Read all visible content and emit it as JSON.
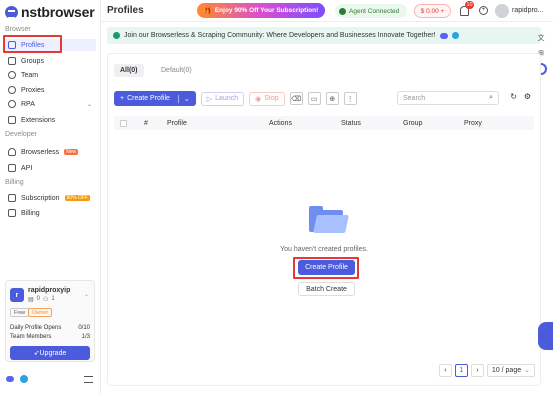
{
  "app": {
    "name": "nstbrowser",
    "page_title": "Profiles"
  },
  "header": {
    "promo_label": "Enjoy 90% Off Your Subscription!",
    "agent_status": "Agent Connected",
    "balance": "$ 0.00 +",
    "notification_count": "10",
    "user_name": "rapidpro..."
  },
  "sidebar": {
    "section_browser": "Browser",
    "section_developer": "Developer",
    "section_billing": "Billing",
    "items": [
      {
        "label": "Profiles"
      },
      {
        "label": "Groups"
      },
      {
        "label": "Team"
      },
      {
        "label": "Proxies"
      },
      {
        "label": "RPA"
      },
      {
        "label": "Extensions"
      },
      {
        "label": "Browserless",
        "badge": "New"
      },
      {
        "label": "API"
      },
      {
        "label": "Subscription",
        "badge": "90% OFF"
      },
      {
        "label": "Billing"
      }
    ],
    "user": {
      "avatar_letter": "r",
      "name": "rapidproxyip",
      "profile_count": "0",
      "member_count": "1",
      "plan_tag": "Free",
      "role_tag": "Owner",
      "daily_opens_label": "Daily Profile Opens",
      "daily_opens_value": "0/10",
      "team_members_label": "Team Members",
      "team_members_value": "1/3",
      "upgrade_label": "Upgrade"
    }
  },
  "community_banner": "Join our Browserless & Scraping Community: Where Developers and Businesses Innovate Together!",
  "tabs": [
    {
      "label": "All(0)"
    },
    {
      "label": "Default(0)"
    }
  ],
  "toolbar": {
    "create_label": "Create Profile",
    "launch_label": "Launch",
    "stop_label": "Stop",
    "search_placeholder": "Search"
  },
  "table": {
    "headers": [
      "#",
      "Profile",
      "Actions",
      "Status",
      "Group",
      "Proxy"
    ]
  },
  "empty_state": {
    "message": "You haven't created profiles.",
    "create_button": "Create Profile",
    "batch_button": "Batch Create"
  },
  "pagination": {
    "current_page": "1",
    "page_size": "10 / page"
  },
  "colors": {
    "accent": "#4b5bdc",
    "highlight": "#e53935"
  }
}
